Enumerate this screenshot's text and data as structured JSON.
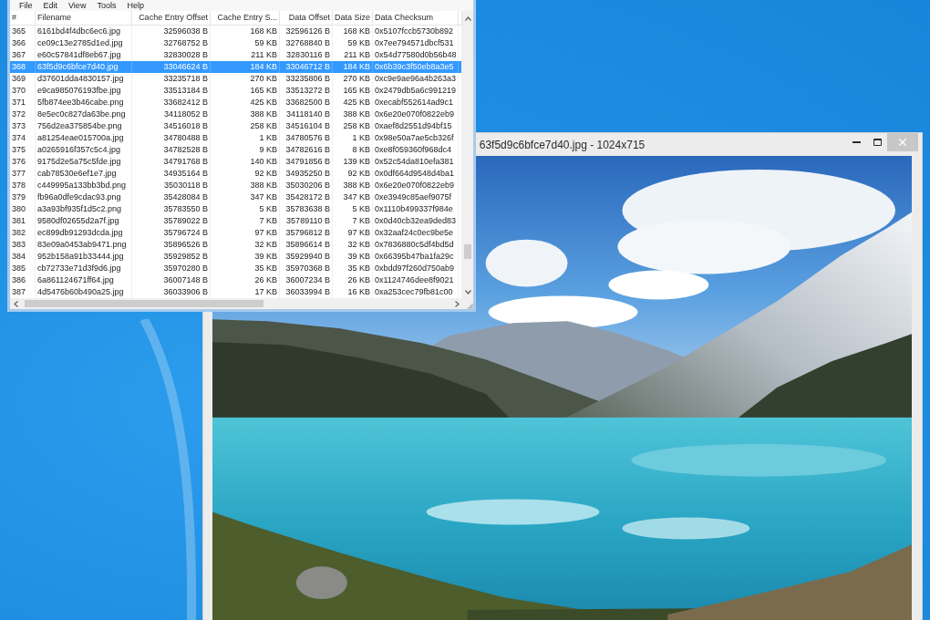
{
  "list_window": {
    "menu": [
      "File",
      "Edit",
      "View",
      "Tools",
      "Help"
    ],
    "columns": [
      "#",
      "Filename",
      "Cache Entry Offset",
      "Cache Entry S...",
      "Data Offset",
      "Data Size",
      "Data Checksum"
    ],
    "rows": [
      {
        "cells": [
          "365",
          "6161bd4f4dbc6ec6.jpg",
          "32596038 B",
          "168 KB",
          "32596126 B",
          "168 KB",
          "0x5107fccb5730b892"
        ],
        "selected": false
      },
      {
        "cells": [
          "366",
          "ce09c13e2785d1ed.jpg",
          "32768752 B",
          "59 KB",
          "32768840 B",
          "59 KB",
          "0x7ee794571dbcf531"
        ],
        "selected": false
      },
      {
        "cells": [
          "367",
          "e60c57841df8eb67.jpg",
          "32830028 B",
          "211 KB",
          "32830116 B",
          "211 KB",
          "0x54d77580d0b56b48"
        ],
        "selected": false
      },
      {
        "cells": [
          "368",
          "63f5d9c6bfce7d40.jpg",
          "33046624 B",
          "184 KB",
          "33046712 B",
          "184 KB",
          "0x6b39c3f50eb8a3e5"
        ],
        "selected": true
      },
      {
        "cells": [
          "369",
          "d37601dda4830157.jpg",
          "33235718 B",
          "270 KB",
          "33235806 B",
          "270 KB",
          "0xc9e9ae96a4b263a3"
        ],
        "selected": false
      },
      {
        "cells": [
          "370",
          "e9ca985076193fbe.jpg",
          "33513184 B",
          "165 KB",
          "33513272 B",
          "165 KB",
          "0x2479db5a6c991219"
        ],
        "selected": false
      },
      {
        "cells": [
          "371",
          "5fb874ee3b46cabe.png",
          "33682412 B",
          "425 KB",
          "33682500 B",
          "425 KB",
          "0xecabf552614ad9c1"
        ],
        "selected": false
      },
      {
        "cells": [
          "372",
          "8e5ec0c827da63be.png",
          "34118052 B",
          "388 KB",
          "34118140 B",
          "388 KB",
          "0x6e20e070f0822eb9"
        ],
        "selected": false
      },
      {
        "cells": [
          "373",
          "756d2ea375854be.png",
          "34516018 B",
          "258 KB",
          "34516104 B",
          "258 KB",
          "0xaef8d2551d94bf15"
        ],
        "selected": false
      },
      {
        "cells": [
          "374",
          "a81254eae015700a.jpg",
          "34780488 B",
          "1 KB",
          "34780576 B",
          "1 KB",
          "0x98e50a7ae5cb326f"
        ],
        "selected": false
      },
      {
        "cells": [
          "375",
          "a0265916f357c5c4.jpg",
          "34782528 B",
          "9 KB",
          "34782616 B",
          "8 KB",
          "0xe8f059360f968dc4"
        ],
        "selected": false
      },
      {
        "cells": [
          "376",
          "9175d2e5a75c5fde.jpg",
          "34791768 B",
          "140 KB",
          "34791856 B",
          "139 KB",
          "0x52c54da810efa381"
        ],
        "selected": false
      },
      {
        "cells": [
          "377",
          "cab78530e6ef1e7.jpg",
          "34935164 B",
          "92 KB",
          "34935250 B",
          "92 KB",
          "0x0df664d9548d4ba1"
        ],
        "selected": false
      },
      {
        "cells": [
          "378",
          "c449995a133bb3bd.png",
          "35030118 B",
          "388 KB",
          "35030206 B",
          "388 KB",
          "0x6e20e070f0822eb9"
        ],
        "selected": false
      },
      {
        "cells": [
          "379",
          "fb96a0dfe9cdac93.png",
          "35428084 B",
          "347 KB",
          "35428172 B",
          "347 KB",
          "0xe3949c85aef9075f"
        ],
        "selected": false
      },
      {
        "cells": [
          "380",
          "a3a93bf935f1d5c2.png",
          "35783550 B",
          "5 KB",
          "35783638 B",
          "5 KB",
          "0x1110b499337f984e"
        ],
        "selected": false
      },
      {
        "cells": [
          "381",
          "9580df02655d2a7f.jpg",
          "35789022 B",
          "7 KB",
          "35789110 B",
          "7 KB",
          "0x0d40cb32ea9ded83"
        ],
        "selected": false
      },
      {
        "cells": [
          "382",
          "ec899db91293dcda.jpg",
          "35796724 B",
          "97 KB",
          "35796812 B",
          "97 KB",
          "0x32aaf24c0ec9be5e"
        ],
        "selected": false
      },
      {
        "cells": [
          "383",
          "83e09a0453ab9471.png",
          "35896526 B",
          "32 KB",
          "35896614 B",
          "32 KB",
          "0x7836880c5df4bd5d"
        ],
        "selected": false
      },
      {
        "cells": [
          "384",
          "952b158a91b33444.jpg",
          "35929852 B",
          "39 KB",
          "35929940 B",
          "39 KB",
          "0x66395b47ba1fa29c"
        ],
        "selected": false
      },
      {
        "cells": [
          "385",
          "cb72733e71d3f9d6.jpg",
          "35970280 B",
          "35 KB",
          "35970368 B",
          "35 KB",
          "0xbdd97f260d750ab9"
        ],
        "selected": false
      },
      {
        "cells": [
          "386",
          "6a861124671ff64.jpg",
          "36007148 B",
          "26 KB",
          "36007234 B",
          "26 KB",
          "0x1124746dee8f9021"
        ],
        "selected": false
      },
      {
        "cells": [
          "387",
          "4d5476b60b490a25.jpg",
          "36033906 B",
          "17 KB",
          "36033994 B",
          "16 KB",
          "0xa253cec79fb81c00"
        ],
        "selected": false
      }
    ]
  },
  "viewer_window": {
    "title": "63f5d9c6bfce7d40.jpg - 1024x715"
  }
}
